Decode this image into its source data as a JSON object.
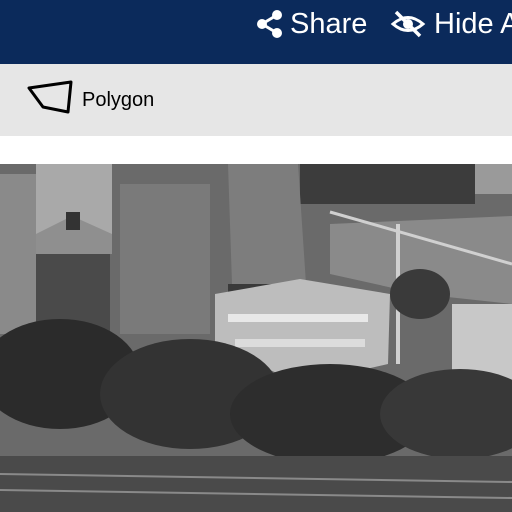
{
  "header": {
    "share": {
      "label": "Share",
      "icon": "share-icon"
    },
    "hide": {
      "label": "Hide A",
      "icon": "eye-slash-icon"
    },
    "background_color": "#0b2a5b"
  },
  "toolbar": {
    "polygon": {
      "label": "Polygon",
      "icon": "polygon-icon"
    },
    "background_color": "#e6e6e6"
  },
  "photo": {
    "kind": "black-and-white aerial photograph",
    "depicts": "campus buildings with a building under construction and cranes"
  }
}
